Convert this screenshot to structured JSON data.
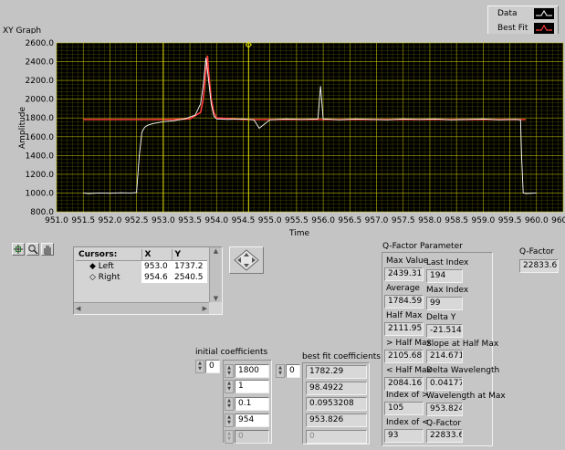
{
  "graph": {
    "title": "XY Graph",
    "xlabel": "Time",
    "ylabel": "Amplitude",
    "legend": {
      "data_label": "Data",
      "fit_label": "Best Fit"
    },
    "colors": {
      "plot_bg": "#000000",
      "grid": "#c8c800",
      "data": "#ffffff",
      "fit": "#ff3c3c",
      "cursor": "#e0e000"
    }
  },
  "chart_data": {
    "type": "line",
    "title": "XY Graph",
    "xlabel": "Time",
    "ylabel": "Amplitude",
    "xlim": [
      951.0,
      960.5
    ],
    "ylim": [
      800.0,
      2600.0
    ],
    "x_ticks": [
      "951.0",
      "951.5",
      "952.0",
      "952.5",
      "953.0",
      "953.5",
      "954.0",
      "954.5",
      "955.0",
      "955.5",
      "956.0",
      "956.5",
      "957.0",
      "957.5",
      "958.0",
      "958.5",
      "959.0",
      "959.5",
      "960.0",
      "960.5"
    ],
    "y_ticks": [
      "800.0",
      "1000.0",
      "1200.0",
      "1400.0",
      "1600.0",
      "1800.0",
      "2000.0",
      "2200.0",
      "2400.0",
      "2600.0"
    ],
    "grid": true,
    "legend_position": "top-right",
    "series": [
      {
        "name": "Data",
        "x": [
          951.5,
          951.6,
          951.8,
          952.0,
          952.2,
          952.4,
          952.5,
          952.55,
          952.6,
          952.65,
          952.7,
          952.8,
          952.9,
          953.0,
          953.2,
          953.4,
          953.6,
          953.7,
          953.75,
          953.8,
          953.85,
          953.9,
          953.95,
          954.0,
          954.2,
          954.5,
          954.7,
          954.8,
          955.0,
          955.3,
          955.6,
          955.9,
          955.95,
          956.0,
          956.05,
          956.3,
          956.6,
          956.9,
          957.2,
          957.5,
          957.8,
          958.1,
          958.4,
          958.7,
          959.0,
          959.3,
          959.6,
          959.7,
          959.72,
          959.75,
          959.8,
          960.0
        ],
        "y": [
          1000,
          995,
          1000,
          998,
          1002,
          1000,
          1005,
          1400,
          1650,
          1700,
          1720,
          1740,
          1750,
          1760,
          1770,
          1790,
          1830,
          1950,
          2150,
          2440,
          2200,
          1950,
          1820,
          1790,
          1785,
          1790,
          1780,
          1690,
          1780,
          1790,
          1785,
          1790,
          2140,
          1785,
          1790,
          1780,
          1790,
          1785,
          1780,
          1790,
          1785,
          1790,
          1780,
          1785,
          1790,
          1780,
          1785,
          1780,
          1400,
          1000,
          995,
          1000
        ]
      },
      {
        "name": "Best Fit",
        "x": [
          951.5,
          952.5,
          953.0,
          953.5,
          953.7,
          953.75,
          953.8,
          953.83,
          953.85,
          953.9,
          953.95,
          954.0,
          954.5,
          955.5,
          956.5,
          957.5,
          958.5,
          959.5,
          959.8
        ],
        "y": [
          1782.3,
          1782.3,
          1783.5,
          1790,
          1860,
          2000,
          2300,
          2465,
          2300,
          2000,
          1860,
          1800,
          1784,
          1782.3,
          1782.3,
          1782.3,
          1782.3,
          1782.3,
          1782.3
        ]
      }
    ],
    "cursors": [
      {
        "name": "Left",
        "x": 953.0,
        "y": 1737.2
      },
      {
        "name": "Right",
        "x": 954.6,
        "y": 2540.5
      }
    ]
  },
  "cursors_table": {
    "headers": [
      "Cursors:",
      "X",
      "Y"
    ],
    "rows": [
      {
        "name": "Left",
        "x": "953.0",
        "y": "1737.2"
      },
      {
        "name": "Right",
        "x": "954.6",
        "y": "2540.5"
      }
    ]
  },
  "qparams": {
    "title": "Q-Factor Parameter",
    "max_value_label": "Max Value",
    "max_value": "2439.31",
    "average_label": "Average",
    "average": "1784.59",
    "half_max_label": "Half Max",
    "half_max": "2111.95",
    "gt_half_max_label": "> Half Max",
    "gt_half_max": "2105.68",
    "lt_half_max_label": "< Half Max",
    "lt_half_max": "2084.16",
    "index_gt_label": "Index of >",
    "index_gt": "105",
    "index_lt_label": "Index of <",
    "index_lt": "93",
    "last_index_label": "Last Index",
    "last_index": "194",
    "max_index_label": "Max Index",
    "max_index": "99",
    "delta_y_label": "Delta Y",
    "delta_y": "-21.5141",
    "slope_label": "Slope at Half Max",
    "slope": "214.671",
    "delta_wl_label": "Delta Wavelength",
    "delta_wl": "0.041772",
    "wl_max_label": "Wavelength at Max",
    "wl_max": "953.824",
    "qfactor_label": "Q-Factor",
    "qfactor": "22833.6"
  },
  "qfactor_out": {
    "label": "Q-Factor",
    "value": "22833.6"
  },
  "initial": {
    "label": "initial coefficients",
    "index": "0",
    "values": [
      "1800",
      "1",
      "0.1",
      "954",
      "0"
    ]
  },
  "bestfit": {
    "label": "best fit coefficients",
    "index": "0",
    "values": [
      "1782.29",
      "98.4922",
      "0.0953208",
      "953.826",
      "0"
    ]
  },
  "tools": {
    "cursor_icon": "crosshair-icon",
    "zoom_icon": "zoom-icon",
    "pan_icon": "hand-icon",
    "move_icon": "diamond-move-icon"
  }
}
